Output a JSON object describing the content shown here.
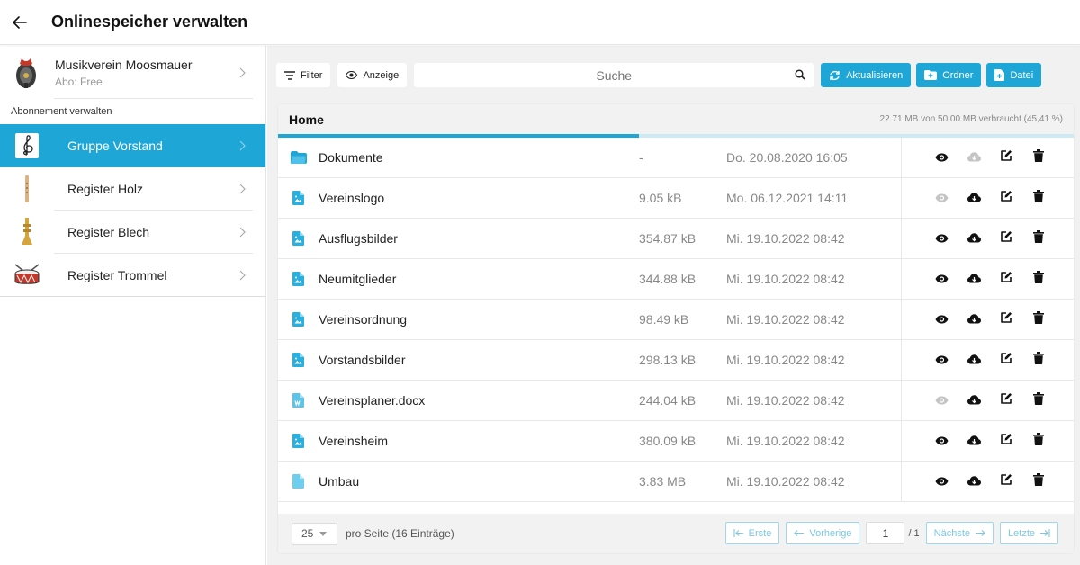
{
  "header": {
    "title": "Onlinespeicher verwalten"
  },
  "sidebar": {
    "org_name": "Musikverein Moosmauer",
    "org_abo": "Abo: Free",
    "manage_label": "Abonnement verwalten",
    "groups": [
      {
        "label": "Gruppe Vorstand",
        "icon": "treble-clef-icon",
        "active": true
      },
      {
        "label": "Register Holz",
        "icon": "flute-icon",
        "active": false
      },
      {
        "label": "Register Blech",
        "icon": "trumpet-icon",
        "active": false
      },
      {
        "label": "Register Trommel",
        "icon": "drum-icon",
        "active": false
      }
    ]
  },
  "toolbar": {
    "filter_label": "Filter",
    "view_label": "Anzeige",
    "search_placeholder": "Suche",
    "refresh_label": "Aktualisieren",
    "folder_label": "Ordner",
    "file_label": "Datei"
  },
  "storage": {
    "title": "Home",
    "usage_text": "22.71 MB von 50.00 MB verbraucht  (45,41 %)",
    "usage_fraction": 0.4541
  },
  "files": [
    {
      "name": "Dokumente",
      "size": "-",
      "date": "Do. 20.08.2020 16:05",
      "type": "folder-icon",
      "view_enabled": true,
      "download_enabled": false
    },
    {
      "name": "Vereinslogo",
      "size": "9.05 kB",
      "date": "Mo. 06.12.2021 14:11",
      "type": "image-file-icon",
      "view_enabled": false,
      "download_enabled": true
    },
    {
      "name": "Ausflugsbilder",
      "size": "354.87 kB",
      "date": "Mi. 19.10.2022 08:42",
      "type": "image-file-icon",
      "view_enabled": true,
      "download_enabled": true
    },
    {
      "name": "Neumitglieder",
      "size": "344.88 kB",
      "date": "Mi. 19.10.2022 08:42",
      "type": "image-file-icon",
      "view_enabled": true,
      "download_enabled": true
    },
    {
      "name": "Vereinsordnung",
      "size": "98.49 kB",
      "date": "Mi. 19.10.2022 08:42",
      "type": "image-file-icon",
      "view_enabled": true,
      "download_enabled": true
    },
    {
      "name": "Vorstandsbilder",
      "size": "298.13 kB",
      "date": "Mi. 19.10.2022 08:42",
      "type": "image-file-icon",
      "view_enabled": true,
      "download_enabled": true
    },
    {
      "name": "Vereinsplaner.docx",
      "size": "244.04 kB",
      "date": "Mi. 19.10.2022 08:42",
      "type": "word-file-icon",
      "view_enabled": false,
      "download_enabled": true
    },
    {
      "name": "Vereinsheim",
      "size": "380.09 kB",
      "date": "Mi. 19.10.2022 08:42",
      "type": "image-file-icon",
      "view_enabled": true,
      "download_enabled": true
    },
    {
      "name": "Umbau",
      "size": "3.83 MB",
      "date": "Mi. 19.10.2022 08:42",
      "type": "blank-file-icon",
      "view_enabled": true,
      "download_enabled": true
    }
  ],
  "footer": {
    "per_page": "25",
    "per_page_label": "pro Seite (16 Einträge)",
    "first_label": "Erste",
    "prev_label": "Vorherige",
    "page_value": "1",
    "page_total": "/ 1",
    "next_label": "Nächste",
    "last_label": "Letzte"
  },
  "colors": {
    "accent": "#1da6d6",
    "disabled_icon": "#c4c4c4",
    "progress_track": "#cde9f4"
  }
}
